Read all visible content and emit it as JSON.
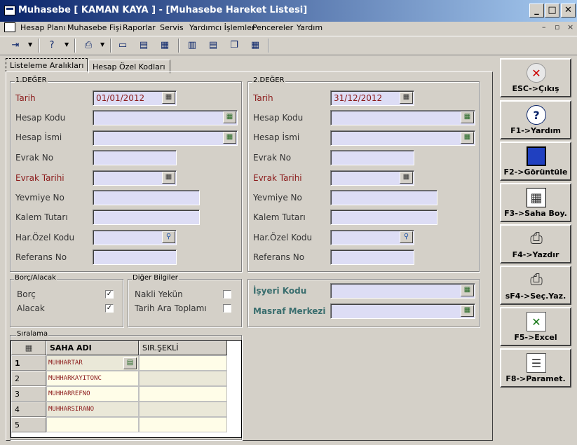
{
  "window": {
    "title": "Muhasebe [ KAMAN KAYA ]  - [Muhasebe Hareket Listesi]",
    "min": "_",
    "max": "□",
    "close": "✕"
  },
  "menu": {
    "items": [
      "Hesap Planı",
      "Muhasebe Fişi",
      "Raporlar",
      "Servis",
      "Yardımcı İşlemler",
      "Pencereler",
      "Yardım"
    ],
    "mdi_min": "–",
    "mdi_restore": "▫",
    "mdi_close": "×"
  },
  "toolbar": {
    "icons": [
      "exit-icon",
      "help-icon",
      "print-setup-icon",
      "window-icon",
      "window-list-icon",
      "window-grid-icon",
      "window-layout-icon",
      "window-tile-icon",
      "window-cascade-icon",
      "calendar-icon"
    ]
  },
  "tabs": [
    {
      "label": "Listeleme Aralıkları"
    },
    {
      "label": "Hesap Özel Kodları"
    }
  ],
  "group1": {
    "title": "1.DEĞER",
    "tarih_label": "Tarih",
    "tarih_value": "01/01/2012",
    "hesap_kodu": "Hesap Kodu",
    "hesap_ismi": "Hesap İsmi",
    "evrak_no": "Evrak No",
    "evrak_tarihi": "Evrak Tarihi",
    "yevmiye_no": "Yevmiye No",
    "kalem_tutari": "Kalem Tutarı",
    "har_ozel_kodu": "Har.Özel Kodu",
    "referans_no": "Referans No"
  },
  "group2": {
    "title": "2.DEĞER",
    "tarih_label": "Tarih",
    "tarih_value": "31/12/2012",
    "hesap_kodu": "Hesap Kodu",
    "hesap_ismi": "Hesap İsmi",
    "evrak_no": "Evrak No",
    "evrak_tarihi": "Evrak Tarihi",
    "yevmiye_no": "Yevmiye No",
    "kalem_tutari": "Kalem Tutarı",
    "har_ozel_kodu": "Har.Özel Kodu",
    "referans_no": "Referans No"
  },
  "borc_alacak": {
    "title": "Borç/Alacak",
    "borc": "Borç",
    "borc_checked": "✓",
    "alacak": "Alacak",
    "alacak_checked": "✓"
  },
  "diger": {
    "title": "Diğer Bilgiler",
    "nakli_yekun": "Nakli Yekün",
    "tarih_ara": "Tarih Ara Toplamı"
  },
  "isyeri": {
    "isyeri_kodu": "İşyeri Kodu",
    "masraf_merkezi": "Masraf Merkezi"
  },
  "siralama": {
    "title": "Sıralama",
    "col1": "SAHA ADI",
    "col2": "SIR.ŞEKLİ",
    "rows": [
      {
        "n": "1",
        "saha": "MUHHARTAR"
      },
      {
        "n": "2",
        "saha": "MUHHARKAYITONC"
      },
      {
        "n": "3",
        "saha": "MUHHARREFNO"
      },
      {
        "n": "4",
        "saha": "MUHHARSIRANO"
      },
      {
        "n": "5",
        "saha": ""
      }
    ]
  },
  "fkeys": [
    {
      "label": "ESC->Çıkış",
      "icon": "close-icon"
    },
    {
      "label": "F1->Yardım",
      "icon": "help-icon"
    },
    {
      "label": "F2->Görüntüle",
      "icon": "monitor-icon"
    },
    {
      "label": "F3->Saha Boy.",
      "icon": "calendar-icon"
    },
    {
      "label": "F4->Yazdır",
      "icon": "printer-icon"
    },
    {
      "label": "sF4->Seç.Yaz.",
      "icon": "printer-select-icon"
    },
    {
      "label": "F5->Excel",
      "icon": "excel-icon"
    },
    {
      "label": "F8->Paramet.",
      "icon": "parameters-icon"
    }
  ]
}
